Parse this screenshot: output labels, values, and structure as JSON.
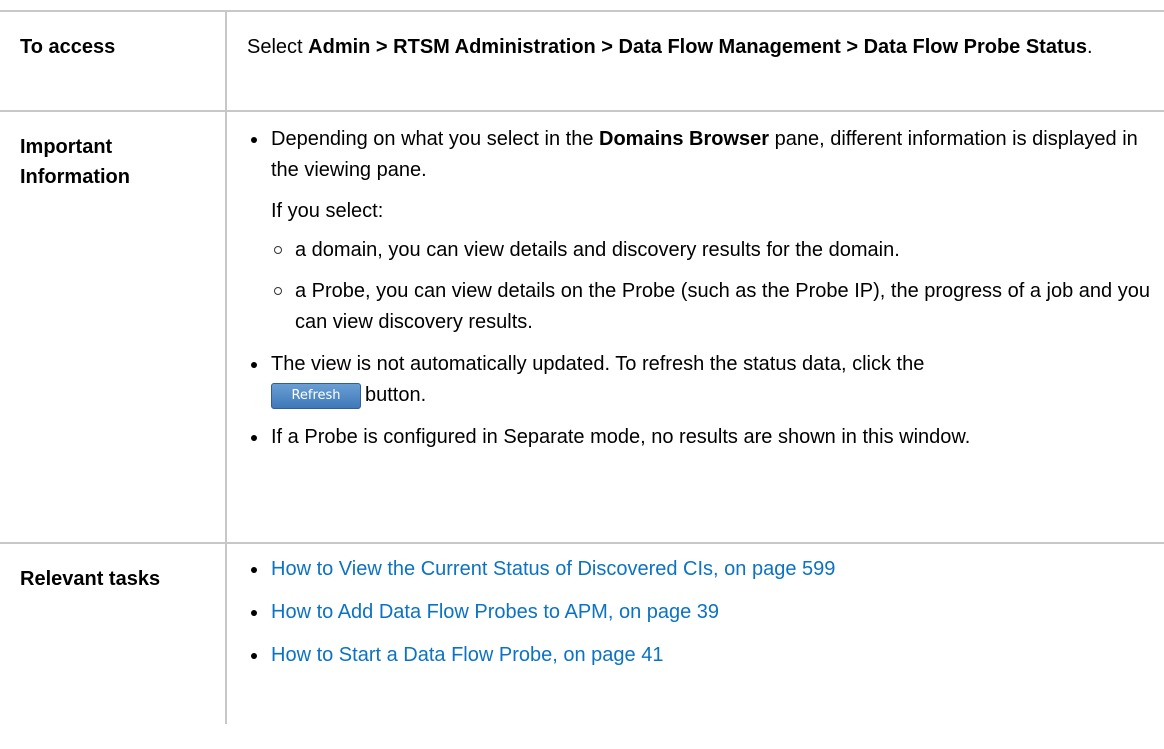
{
  "rows": {
    "access": {
      "label": "To access",
      "prefix": "Select ",
      "path": "Admin > RTSM Administration > Data Flow Management > Data Flow Probe Status",
      "suffix": "."
    },
    "important": {
      "label": "Important Information",
      "bullet1": {
        "pre": "Depending on what you select in the ",
        "bold": "Domains Browser",
        "post": " pane, different information is displayed in the viewing pane."
      },
      "if_select": "If you select:",
      "sub1": "a domain, you can view details and discovery results for the domain.",
      "sub2": "a Probe, you can view details on the Probe (such as the Probe IP), the progress of a job and you can view discovery results.",
      "bullet2_pre": "The view is not automatically updated. To refresh the status data, click the",
      "refresh_label": "Refresh",
      "bullet2_post": "button.",
      "bullet3": "If a Probe is configured in Separate mode, no results are shown in this window."
    },
    "tasks": {
      "label": "Relevant tasks",
      "links": [
        "How to View the Current Status of Discovered CIs, on page 599",
        "How to Add Data Flow Probes to APM, on page 39",
        "How to Start a Data Flow Probe, on page 41"
      ]
    }
  },
  "colors": {
    "link": "#0b72c4",
    "border": "#c8c8c8"
  }
}
